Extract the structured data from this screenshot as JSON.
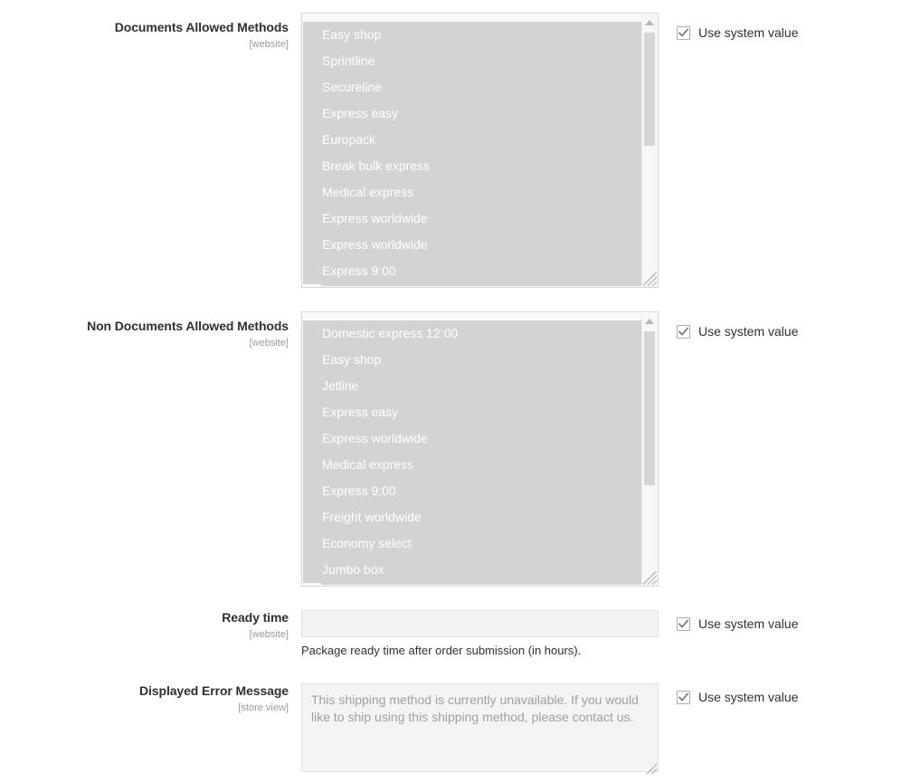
{
  "rows": [
    {
      "label": "Documents Allowed Methods",
      "scope": "[website]",
      "options": [
        "Easy shop",
        "Sprintline",
        "Secureline",
        "Express easy",
        "Europack",
        "Break bulk express",
        "Medical express",
        "Express worldwide",
        "Express worldwide",
        "Express 9:00"
      ],
      "system_value_label": "Use system value"
    },
    {
      "label": "Non Documents Allowed Methods",
      "scope": "[website]",
      "options": [
        "Domestic express 12:00",
        "Easy shop",
        "Jetline",
        "Express easy",
        "Express worldwide",
        "Medical express",
        "Express 9:00",
        "Freight worldwide",
        "Economy select",
        "Jumbo box"
      ],
      "system_value_label": "Use system value"
    },
    {
      "label": "Ready time",
      "scope": "[website]",
      "input_value": "",
      "input_placeholder": "",
      "help": "Package ready time after order submission (in hours).",
      "system_value_label": "Use system value"
    },
    {
      "label": "Displayed Error Message",
      "scope": "[store view]",
      "textarea_value": "This shipping method is currently unavailable. If you would like to ship using this shipping method, please contact us.",
      "system_value_label": "Use system value"
    }
  ],
  "icons": {
    "scroll_up": "triangle-up-icon",
    "scroll_down": "triangle-down-icon",
    "resize": "resize-grip-icon",
    "check": "checkmark-icon"
  },
  "colors": {
    "selection_bg": "#d3d3d3",
    "selection_text": "#ffffff",
    "label_text": "#303030",
    "scope_text": "#9b9b9b",
    "field_border": "#d6d6d6"
  }
}
